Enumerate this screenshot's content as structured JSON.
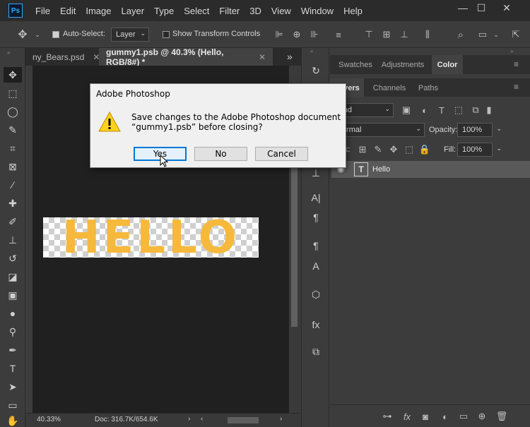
{
  "app": {
    "logo": "Ps"
  },
  "menubar": {
    "items": [
      "File",
      "Edit",
      "Image",
      "Layer",
      "Type",
      "Select",
      "Filter",
      "3D",
      "View",
      "Window",
      "Help"
    ]
  },
  "window_controls": {
    "minimize": "—",
    "restore": "☐",
    "close": "✕"
  },
  "options_bar": {
    "auto_select_label": "Auto-Select:",
    "auto_select_checked": true,
    "auto_select_target": "Layer",
    "show_transform_label": "Show Transform Controls",
    "show_transform_checked": false
  },
  "tabs": [
    {
      "label": "ny_Bears.psd",
      "active": false
    },
    {
      "label": "gummy1.psb @ 40.3% (Hello, RGB/8#) *",
      "active": true
    }
  ],
  "tab_overflow": "»",
  "canvas": {
    "text": "HELLO",
    "text_color": "#f6b93b"
  },
  "status": {
    "zoom": "40.33%",
    "doc": "Doc: 316.7K/654.6K"
  },
  "panels": {
    "top_tabs": [
      "Swatches",
      "Adjustments",
      "Color"
    ],
    "top_active": "Color",
    "layers_tabs": [
      "Layers",
      "Channels",
      "Paths"
    ],
    "filter_kind": "Kind",
    "blend_mode": "Normal",
    "opacity_label": "Opacity:",
    "opacity_value": "100%",
    "lock_label": "Lock:",
    "fill_label": "Fill:",
    "fill_value": "100%",
    "layer_name": "Hello"
  },
  "dialog": {
    "title": "Adobe Photoshop",
    "message_line1": "Save changes to the Adobe Photoshop document",
    "message_line2": "“gummy1.psb” before closing?",
    "buttons": {
      "yes": "Yes",
      "no": "No",
      "cancel": "Cancel"
    }
  }
}
